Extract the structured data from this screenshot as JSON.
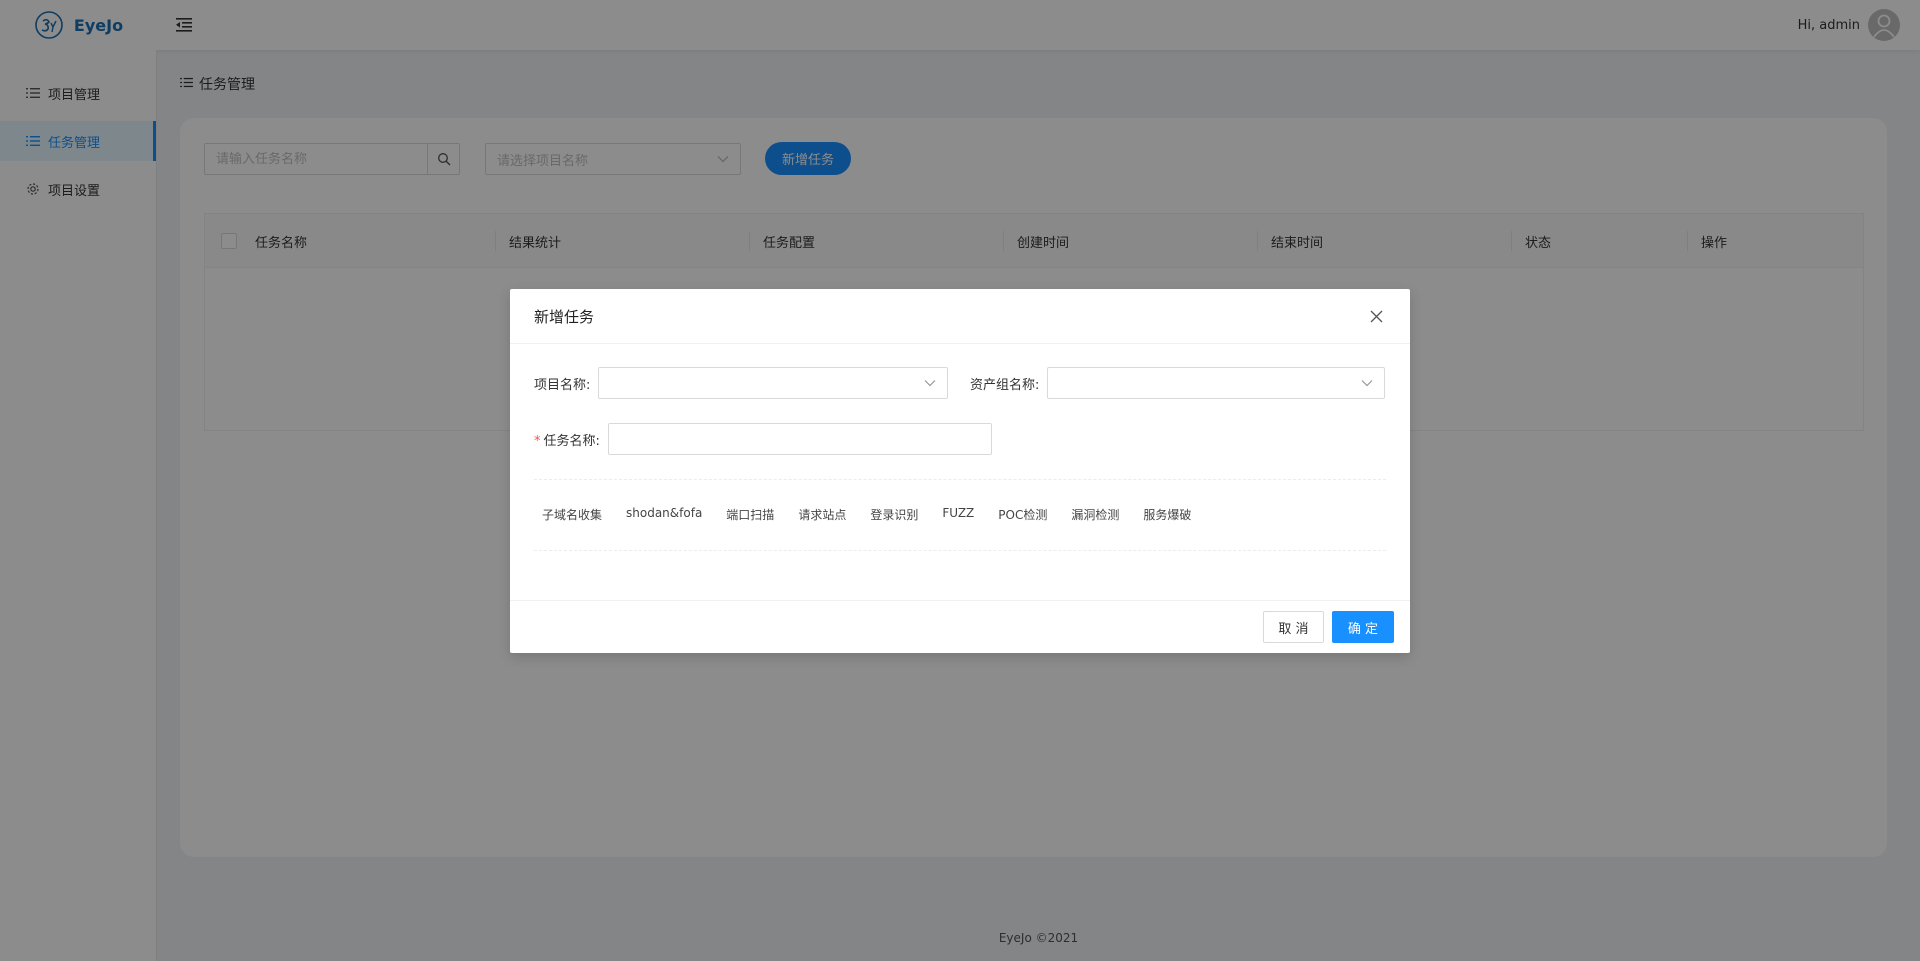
{
  "header": {
    "app_name": "EyeJo",
    "greeting": "Hi, admin"
  },
  "sidebar": {
    "items": [
      {
        "label": "项目管理",
        "icon": "list-icon",
        "active": false
      },
      {
        "label": "任务管理",
        "icon": "list-icon",
        "active": true
      },
      {
        "label": "项目设置",
        "icon": "gear-icon",
        "active": false
      }
    ]
  },
  "breadcrumb": {
    "label": "任务管理"
  },
  "toolbar": {
    "search_placeholder": "请输入任务名称",
    "project_select_placeholder": "请选择项目名称",
    "add_label": "新增任务"
  },
  "table": {
    "columns": [
      "任务名称",
      "结果统计",
      "任务配置",
      "创建时间",
      "结束时间",
      "状态",
      "操作"
    ],
    "rows": []
  },
  "footer": {
    "text": "EyeJo ©2021"
  },
  "modal": {
    "title": "新增任务",
    "project_label": "项目名称:",
    "asset_group_label": "资产组名称:",
    "task_name_required_mark": "*",
    "task_name_label": "任务名称:",
    "task_name_value": "",
    "tabs": [
      "子域名收集",
      "shodan&fofa",
      "端口扫描",
      "请求站点",
      "登录识别",
      "FUZZ",
      "POC检测",
      "漏洞检测",
      "服务爆破"
    ],
    "cancel_label": "取 消",
    "ok_label": "确 定"
  },
  "colors": {
    "primary": "#1890ff",
    "mask": "rgba(0,0,0,0.45)",
    "required": "#ff4d4f"
  }
}
